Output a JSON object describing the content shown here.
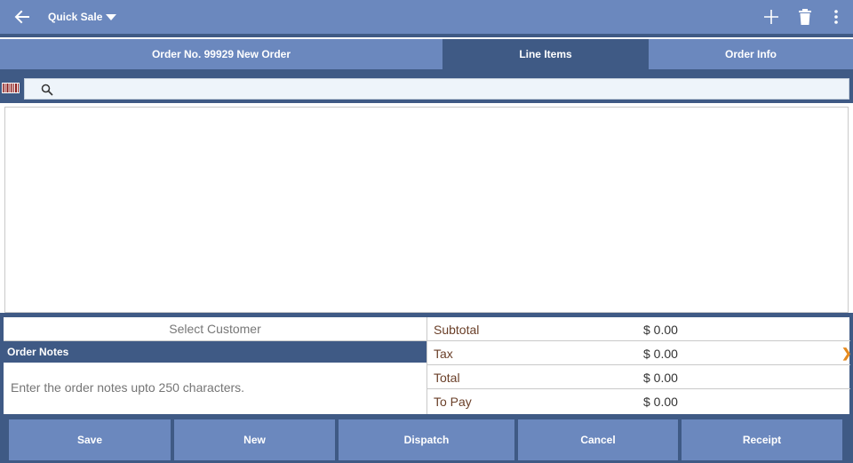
{
  "appbar": {
    "title": "Quick Sale",
    "icons": [
      "back-arrow-icon",
      "caret-down-icon",
      "plus-icon",
      "trash-icon",
      "more-vert-icon"
    ]
  },
  "tabs": [
    {
      "label": "Order No. 99929 New Order",
      "active": false
    },
    {
      "label": "Line Items",
      "active": true
    },
    {
      "label": "Order Info",
      "active": false
    }
  ],
  "search": {
    "value": "",
    "placeholder": ""
  },
  "customer": {
    "label": "Select Customer"
  },
  "notes": {
    "header": "Order Notes",
    "placeholder": "Enter the order notes upto 250 characters."
  },
  "totals": {
    "rows": [
      {
        "label": "Subtotal",
        "value": "$ 0.00"
      },
      {
        "label": "Tax",
        "value": "$ 0.00"
      },
      {
        "label": "Total",
        "value": "$ 0.00"
      },
      {
        "label": "To Pay",
        "value": "$ 0.00"
      }
    ],
    "tax_arrow": "❯"
  },
  "actions": {
    "save": "Save",
    "new": "New",
    "dispatch": "Dispatch",
    "cancel": "Cancel",
    "receipt": "Receipt"
  },
  "colors": {
    "primary": "#6b88be",
    "dark": "#3f5a85",
    "label_brown": "#6a3f28",
    "accent_orange": "#e58a1f"
  }
}
